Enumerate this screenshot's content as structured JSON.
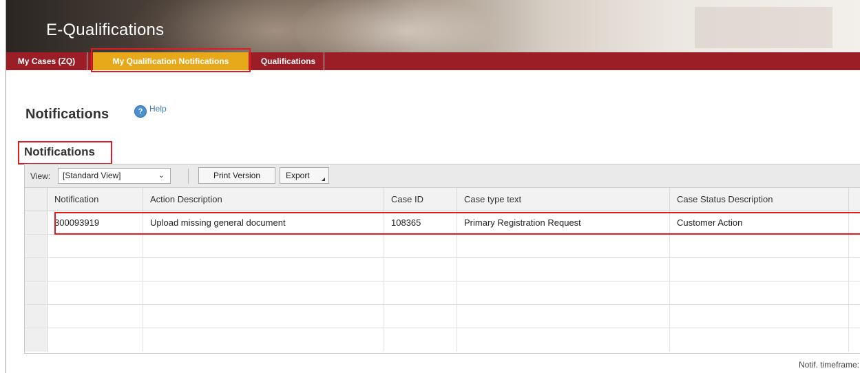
{
  "app": {
    "title": "E-Qualifications"
  },
  "nav": {
    "tabs": [
      {
        "label": "My Cases (ZQ)",
        "active": false
      },
      {
        "label": "My Qualification Notifications",
        "active": true
      },
      {
        "label": "Qualifications",
        "active": false
      }
    ]
  },
  "page": {
    "title": "Notifications",
    "help_label": "Help"
  },
  "section": {
    "title": "Notifications"
  },
  "toolbar": {
    "view_label": "View:",
    "view_selected": "[Standard View]",
    "print_label": "Print Version",
    "export_label": "Export"
  },
  "table": {
    "columns": [
      "Notification",
      "Action Description",
      "Case ID",
      "Case type text",
      "Case Status Description"
    ],
    "rows": [
      [
        "300093919",
        "Upload missing general document",
        "108365",
        "Primary Registration Request",
        "Customer Action"
      ]
    ]
  },
  "footer": {
    "timeframe_label": "Notif. timeframe:"
  },
  "colors": {
    "nav_bg": "#9b1d25",
    "active_tab": "#e7a91a",
    "highlight": "#e21a22"
  }
}
